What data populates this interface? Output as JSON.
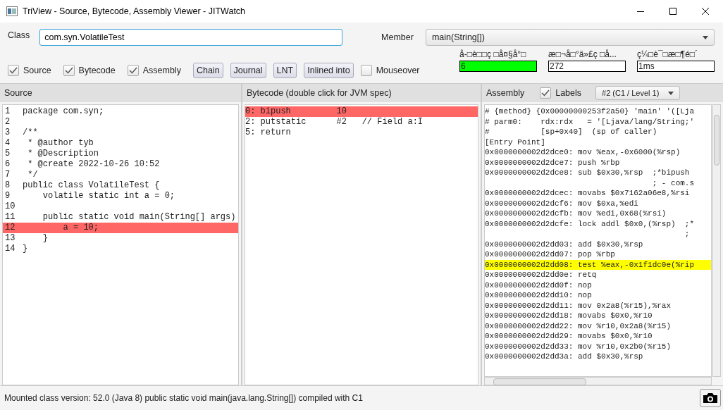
{
  "window": {
    "title": "TriView - Source, Bytecode, Assembly Viewer - JITWatch"
  },
  "class_field": {
    "label": "Class",
    "value": "com.syn.VolatileTest"
  },
  "member": {
    "label": "Member",
    "value": "main(String[])"
  },
  "toggles": [
    {
      "label": "Source",
      "checked": true
    },
    {
      "label": "Bytecode",
      "checked": true
    },
    {
      "label": "Assembly",
      "checked": true
    }
  ],
  "buttons": [
    "Chain",
    "Journal",
    "LNT",
    "Inlined into"
  ],
  "mouseover": {
    "label": "Mouseover",
    "checked": false
  },
  "stats": [
    {
      "label": "å-□è□□ç □å¤§å°□",
      "value": "6",
      "color": "#00ff00"
    },
    {
      "label": "æ□¬å□°ä»£ç □å...",
      "value": "272",
      "color": "#ffffff"
    },
    {
      "label": "ç¼□è¯□æ□¶é□´",
      "value": "1ms",
      "color": "#ffffff"
    }
  ],
  "source": {
    "title": "Source",
    "lines": [
      {
        "number": "1",
        "text": "package com.syn;",
        "highlighted": false
      },
      {
        "number": "2",
        "highlighted": false
      },
      {
        "number": "3",
        "text": "/**",
        "highlighted": false
      },
      {
        "number": "4",
        "text": " * @author tyb",
        "highlighted": false
      },
      {
        "number": "5",
        "text": " * @Description",
        "highlighted": false
      },
      {
        "number": "6",
        "text": " * @create 2022-10-26 10:52",
        "highlighted": false
      },
      {
        "number": "7",
        "text": " */",
        "highlighted": false
      },
      {
        "number": "8",
        "text": "public class VolatileTest {",
        "highlighted": false
      },
      {
        "number": "9",
        "text": "    volatile static int a = 0;",
        "highlighted": false
      },
      {
        "number": "10",
        "highlighted": false
      },
      {
        "number": "11",
        "text": "    public static void main(String[] args)",
        "highlighted": false
      },
      {
        "number": "12",
        "text": "        a = 10;",
        "highlighted": true
      },
      {
        "number": "13",
        "text": "    }",
        "highlighted": false
      },
      {
        "number": "14",
        "text": "}",
        "highlighted": false
      }
    ]
  },
  "bytecode": {
    "title": "Bytecode (double click for JVM spec)",
    "lines": [
      {
        "text": "0: bipush         10",
        "highlighted": true
      },
      {
        "text": "2: putstatic      #2   // Field a:I",
        "highlighted": false
      },
      {
        "text": "5: return",
        "highlighted": false
      }
    ]
  },
  "assembly": {
    "title": "Assembly",
    "labels": {
      "label": "Labels",
      "checked": true
    },
    "compilation": "#2  (C1 / Level 1)",
    "lines": [
      {
        "text": "# {method} {0x00000000253f2a50} 'main' '([Lja",
        "highlighted": false
      },
      {
        "text": "# parm0:    rdx:rdx   = '[Ljava/lang/String;'",
        "highlighted": false
      },
      {
        "text": "#           [sp+0x40]  (sp of caller)",
        "highlighted": false
      },
      {
        "text": "[Entry Point]",
        "highlighted": false
      },
      {
        "text": "0x0000000002d2dce0: mov %eax,-0x6000(%rsp)",
        "highlighted": false
      },
      {
        "text": "0x0000000002d2dce7: push %rbp",
        "highlighted": false
      },
      {
        "text": "0x0000000002d2dce8: sub $0x30,%rsp  ;*bipush",
        "highlighted": false
      },
      {
        "text": "                                    ; - com.s",
        "highlighted": false
      },
      {
        "text": "0x0000000002d2dcec: movabs $0x7162a06e8,%rsi",
        "highlighted": false
      },
      {
        "text": "0x0000000002d2dcf6: mov $0xa,%edi",
        "highlighted": false
      },
      {
        "text": "0x0000000002d2dcfb: mov %edi,0x68(%rsi)",
        "highlighted": false
      },
      {
        "text": "0x0000000002d2dcfe: lock addl $0x0,(%rsp)  ;*",
        "highlighted": false
      },
      {
        "text": "                                           ;",
        "highlighted": false
      },
      {
        "text": "0x0000000002d2dd03: add $0x30,%rsp",
        "highlighted": false
      },
      {
        "text": "0x0000000002d2dd07: pop %rbp",
        "highlighted": false
      },
      {
        "text": "0x0000000002d2dd08: test %eax,-0x1f1dc0e(%rip",
        "highlighted": true
      },
      {
        "text": "0x0000000002d2dd0e: retq",
        "highlighted": false
      },
      {
        "text": "0x0000000002d2dd0f: nop",
        "highlighted": false
      },
      {
        "text": "0x0000000002d2dd10: nop",
        "highlighted": false
      },
      {
        "text": "0x0000000002d2dd11: mov 0x2a8(%r15),%rax",
        "highlighted": false
      },
      {
        "text": "0x0000000002d2dd18: movabs $0x0,%r10",
        "highlighted": false
      },
      {
        "text": "0x0000000002d2dd22: mov %r10,0x2a8(%r15)",
        "highlighted": false
      },
      {
        "text": "0x0000000002d2dd29: movabs $0x0,%r10",
        "highlighted": false
      },
      {
        "text": "0x0000000002d2dd33: mov %r10,0x2b0(%r15)",
        "highlighted": false
      },
      {
        "text": "0x0000000002d2dd3a: add $0x30,%rsp",
        "highlighted": false
      }
    ]
  },
  "status_bar": {
    "text": "Mounted class version: 52.0 (Java 8) public static void main(java.lang.String[]) compiled with C1"
  }
}
